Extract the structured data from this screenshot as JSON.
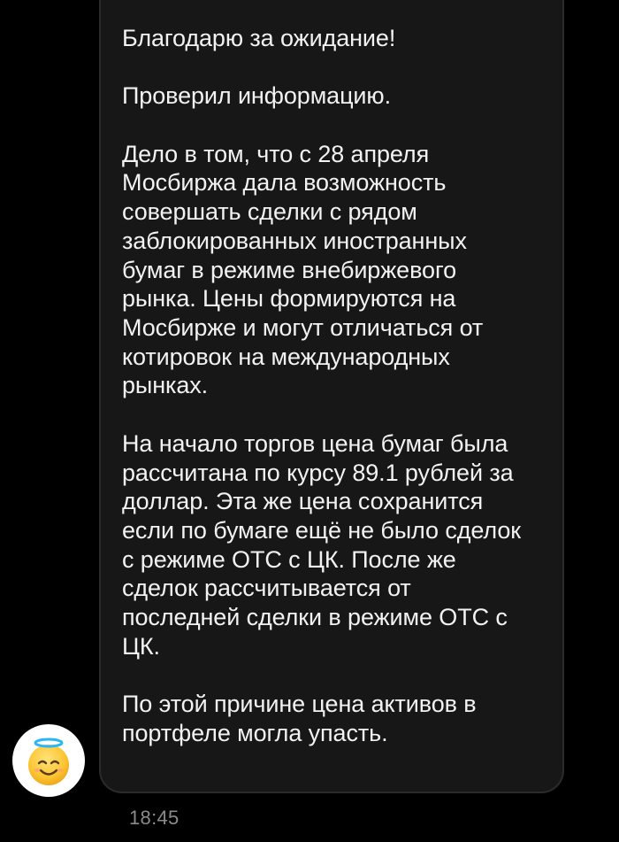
{
  "message": {
    "paragraphs": [
      "Благодарю за ожидание!",
      "Проверил информацию.",
      "Дело в том, что с 28 апреля\nМосбиржа дала возможность\nсовершать сделки с рядом\nзаблокированных иностранных\nбумаг в режиме внебиржевого\nрынка. Цены формируются на\nМосбирже и могут отличаться от\nкотировок на международных\nрынках.",
      "На начало торгов цена бумаг была\nрассчитана по курсу 89.1 рублей за\nдоллар. Эта же цена сохранится\nесли по бумаге ещё не было сделок\nс режиме ОТС с ЦК. После же\nсделок рассчитывается от\nпоследней сделки в режиме ОТС с\nЦК.",
      "По этой причине цена активов в\nпортфеле могла упасть."
    ],
    "time": "18:45"
  },
  "sender": {
    "avatar_icon": "smiling-face-with-halo-icon"
  },
  "colors": {
    "background": "#000000",
    "bubble": "#171717",
    "bubble_border": "#2b2b2b",
    "text": "#f2f2f2",
    "timestamp": "#8a8a8a",
    "avatar_bg": "#ffffff"
  }
}
